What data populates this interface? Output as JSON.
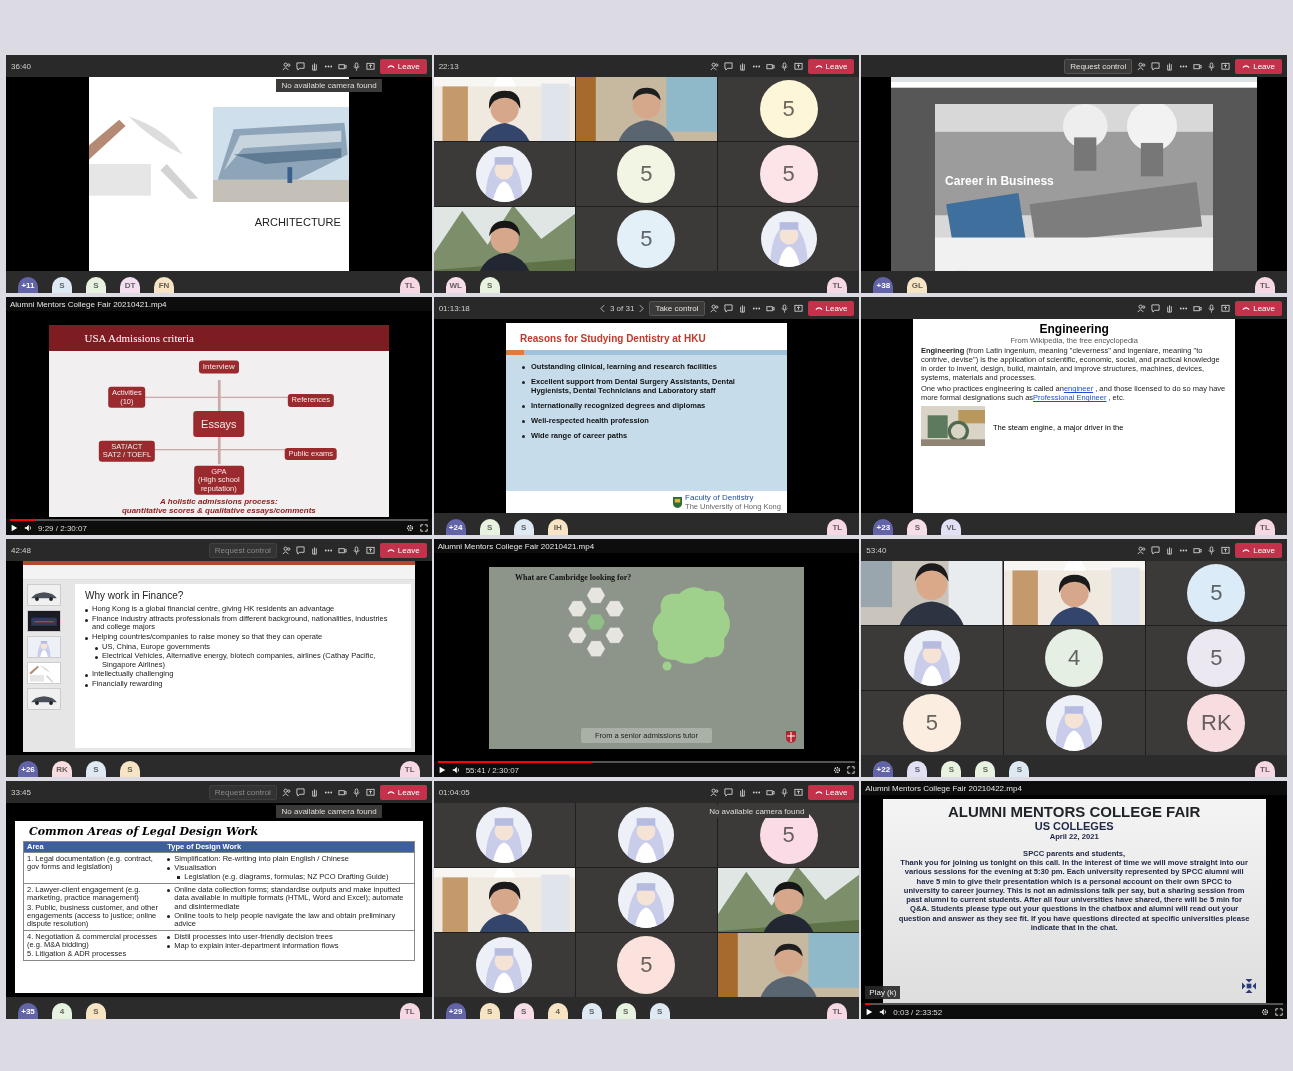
{
  "tiles": [
    {
      "kind": "teams",
      "time": "36:40",
      "leave": "Leave",
      "tooltip": "No available camera found",
      "content": {
        "kind": "architecture",
        "title": "ARCHITECTURE"
      },
      "strip": [
        {
          "kind": "count",
          "text": "+11",
          "color": "#6264a7"
        },
        {
          "kind": "initial",
          "text": "S",
          "color": "#dfe9f3"
        },
        {
          "kind": "initial",
          "text": "S",
          "color": "#e7f3e0"
        },
        {
          "kind": "initial",
          "text": "DT",
          "color": "#f3dff0"
        },
        {
          "kind": "initial",
          "text": "FN",
          "color": "#f6e4c4"
        },
        {
          "kind": "initial",
          "text": "TL",
          "color": "#f6d8e4"
        }
      ]
    },
    {
      "kind": "teams",
      "time": "22:13",
      "leave": "Leave",
      "content": {
        "kind": "gallery",
        "people": [
          {
            "kind": "camera"
          },
          {
            "kind": "camera"
          },
          {
            "kind": "initial",
            "text": "5",
            "color": "#fdf6d8"
          },
          {
            "kind": "avatar"
          },
          {
            "kind": "initial",
            "text": "5",
            "color": "#f3f5e4"
          },
          {
            "kind": "initial",
            "text": "5",
            "color": "#fce4e8"
          },
          {
            "kind": "camera"
          },
          {
            "kind": "initial",
            "text": "5",
            "color": "#e4f0f8"
          },
          {
            "kind": "avatar"
          }
        ]
      },
      "strip": [
        {
          "kind": "initial",
          "text": "WL",
          "color": "#f6dde8"
        },
        {
          "kind": "initial",
          "text": "S",
          "color": "#e7f3e0"
        },
        {
          "kind": "initial",
          "text": "TL",
          "color": "#f6d8e4"
        }
      ]
    },
    {
      "kind": "teams",
      "request": {
        "label": "Request control",
        "disabled": false
      },
      "leave": "Leave",
      "content": {
        "kind": "business",
        "title": "Career in Business"
      },
      "strip": [
        {
          "kind": "count",
          "text": "+38",
          "color": "#6264a7"
        },
        {
          "kind": "initial",
          "text": "GL",
          "color": "#f6e4c4"
        },
        {
          "kind": "initial",
          "text": "TL",
          "color": "#f6d8e4"
        }
      ]
    },
    {
      "kind": "video",
      "file": "Alumni Mentors College Fair 20210421.mp4",
      "clock": "9:29 / 2:30:07",
      "level": 0.06,
      "content": {
        "kind": "criteria",
        "title": "USA Admissions criteria",
        "nodes": [
          {
            "text": "Interview",
            "center": false
          },
          {
            "text": "Activities\n(10)",
            "center": false
          },
          {
            "text": "References",
            "center": false
          },
          {
            "text": "Essays",
            "center": true
          },
          {
            "text": "SAT/ACT\nSAT2 / TOEFL",
            "center": false
          },
          {
            "text": "Public exams",
            "center": false
          },
          {
            "text": "GPA\n(High school\nreputation)",
            "center": false
          }
        ],
        "footer": [
          "A holistic admissions process:",
          "quantitative scores & qualitative essays/comments"
        ]
      }
    },
    {
      "kind": "teams",
      "time": "01:13:18",
      "pager": "3 of 31",
      "request": {
        "label": "Take control",
        "disabled": false
      },
      "leave": "Leave",
      "content": {
        "kind": "bullets",
        "title": "Reasons for Studying Dentistry at HKU",
        "items": [
          "Outstanding clinical, learning and research facilities",
          "Excellent support from Dental Surgery Assistants, Dental Hygienists, Dental Technicians and Laboratory staff",
          "Internationally recognized degrees and diplomas",
          "Well-respected health profession",
          "Wide range of career paths"
        ],
        "brand": "Faculty of Dentistry",
        "brand_sub": "The University of Hong Kong"
      },
      "strip": [
        {
          "kind": "count",
          "text": "+24",
          "color": "#6264a7"
        },
        {
          "kind": "initial",
          "text": "S",
          "color": "#e7f3e0"
        },
        {
          "kind": "initial",
          "text": "S",
          "color": "#dfe9f3"
        },
        {
          "kind": "initial",
          "text": "IH",
          "color": "#f6e4c4"
        },
        {
          "kind": "initial",
          "text": "TL",
          "color": "#f6d8e4"
        }
      ]
    },
    {
      "kind": "teams",
      "leave": "Leave",
      "content": {
        "kind": "engineering",
        "title": "Engineering",
        "subtitle": "From Wikipedia, the free encyclopedia",
        "para": "**Engineering** (from Latin ingenium, meaning \"cleverness\" and ingeniare, meaning \"to contrive, devise\") is the application of scientific, economic, social, and practical knowledge in order to invent, design, build, maintain, and improve structures, machines, devices, systems, materials and processes.",
        "segments": [
          {
            "text": "One who practices engineering is called an",
            "link": false
          },
          {
            "text": "engineer",
            "link": true
          },
          {
            "text": ", and those licensed to do so may have more formal designations such as",
            "link": false
          },
          {
            "text": "Professional Engineer",
            "link": true
          },
          {
            "text": ", etc.",
            "link": false
          }
        ],
        "caption": "The steam engine, a major driver in the"
      },
      "strip": [
        {
          "kind": "count",
          "text": "+23",
          "color": "#6264a7"
        },
        {
          "kind": "initial",
          "text": "S",
          "color": "#f6dde8"
        },
        {
          "kind": "initial",
          "text": "VL",
          "color": "#e2e0f4"
        },
        {
          "kind": "initial",
          "text": "TL",
          "color": "#f6d8e4"
        }
      ]
    },
    {
      "kind": "teams",
      "time": "42:48",
      "request": {
        "label": "Request control",
        "disabled": true
      },
      "leave": "Leave",
      "content": {
        "kind": "finance",
        "title": "Why work in Finance?",
        "bullets": [
          {
            "text": "Hong Kong is a global financial centre, giving HK residents an advantage"
          },
          {
            "text": "Finance industry attracts professionals from different background, nationalities, industries and college majors"
          },
          {
            "text": "Helping countries/companies to raise money so that they can operate",
            "subs": [
              "US, China, Europe governments",
              "Electrical Vehicles, Alternative energy, biotech companies, airlines (Cathay Pacific, Singapore Airlines)"
            ]
          },
          {
            "text": "Intellectually challenging"
          },
          {
            "text": "Financially rewarding"
          }
        ]
      },
      "strip": [
        {
          "kind": "count",
          "text": "+26",
          "color": "#6264a7"
        },
        {
          "kind": "initial",
          "text": "RK",
          "color": "#f8dde0"
        },
        {
          "kind": "initial",
          "text": "S",
          "color": "#dfe9f3"
        },
        {
          "kind": "initial",
          "text": "S",
          "color": "#f6e4c4"
        },
        {
          "kind": "initial",
          "text": "TL",
          "color": "#f6d8e4"
        }
      ]
    },
    {
      "kind": "video",
      "file": "Alumni Mentors College Fair 20210421.mp4",
      "clock": "55:41 / 2:30:07",
      "level": 0.37,
      "content": {
        "kind": "cambridge",
        "title": "What are Cambridge looking for?",
        "caption": "From a senior admissions tutor"
      }
    },
    {
      "kind": "teams",
      "time": "53:40",
      "leave": "Leave",
      "content": {
        "kind": "gallery",
        "people": [
          {
            "kind": "camera"
          },
          {
            "kind": "camera"
          },
          {
            "kind": "initial",
            "text": "5",
            "color": "#dcebf8"
          },
          {
            "kind": "avatar"
          },
          {
            "kind": "initial",
            "text": "4",
            "color": "#e6efe3"
          },
          {
            "kind": "initial",
            "text": "5",
            "color": "#ece8f2"
          },
          {
            "kind": "initial",
            "text": "5",
            "color": "#fbeee0"
          },
          {
            "kind": "avatar"
          },
          {
            "kind": "initial",
            "text": "RK",
            "color": "#f8dde0"
          }
        ]
      },
      "strip": [
        {
          "kind": "count",
          "text": "+22",
          "color": "#6264a7"
        },
        {
          "kind": "initial",
          "text": "S",
          "color": "#e2e0f4"
        },
        {
          "kind": "initial",
          "text": "S",
          "color": "#e7f3e0"
        },
        {
          "kind": "initial",
          "text": "S",
          "color": "#e7f3e0"
        },
        {
          "kind": "initial",
          "text": "S",
          "color": "#dfe9f3"
        },
        {
          "kind": "initial",
          "text": "TL",
          "color": "#f6d8e4"
        }
      ]
    },
    {
      "kind": "teams",
      "time": "33:45",
      "request": {
        "label": "Request control",
        "disabled": true
      },
      "leave": "Leave",
      "tooltip": "No available camera found",
      "content": {
        "kind": "legal",
        "title": "Common Areas of Legal Design Work",
        "columns": [
          "Area",
          "Type of Design Work"
        ],
        "groups": [
          {
            "areas": [
              "1.  Legal documentation (e.g. contract, gov forms and legislation)"
            ],
            "work": [
              {
                "text": "Simplification: Re-writing into plain English / Chinese",
                "sub": false
              },
              {
                "text": "Visualisation",
                "sub": false
              },
              {
                "text": "Legislation (e.g. diagrams, formulas; NZ PCO Drafting Guide)",
                "sub": true
              }
            ]
          },
          {
            "areas": [
              "2.  Lawyer-client engagement (e.g. marketing, practice management)",
              "3.  Public, business customer, and other engagements (access to justice; online dispute resolution)"
            ],
            "work": [
              {
                "text": "Online data collection forms; standardise outputs and make inputted data available in multiple formats (HTML, Word and Excel); automate and disintermediate",
                "sub": false
              },
              {
                "text": "Online tools to help people navigate the law and obtain preliminary advice",
                "sub": false
              }
            ]
          },
          {
            "areas": [
              "4.  Negotiation & commercial processes (e.g. M&A bidding)",
              "5.  Litigation & ADR processes"
            ],
            "work": [
              {
                "text": "Distil processes into user-friendly decision trees",
                "sub": false
              },
              {
                "text": "Map to explain inter-department information flows",
                "sub": false
              }
            ]
          }
        ]
      },
      "strip": [
        {
          "kind": "count",
          "text": "+35",
          "color": "#6264a7"
        },
        {
          "kind": "initial",
          "text": "4",
          "color": "#e7f3e0"
        },
        {
          "kind": "initial",
          "text": "S",
          "color": "#f6e4c4"
        },
        {
          "kind": "initial",
          "text": "TL",
          "color": "#f6d8e4"
        }
      ]
    },
    {
      "kind": "teams",
      "time": "01:04:05",
      "leave": "Leave",
      "tooltip": "No available camera found",
      "content": {
        "kind": "gallery",
        "people": [
          {
            "kind": "avatar"
          },
          {
            "kind": "avatar"
          },
          {
            "kind": "initial",
            "text": "5",
            "color": "#fbdce6"
          },
          {
            "kind": "camera"
          },
          {
            "kind": "avatar"
          },
          {
            "kind": "camera"
          },
          {
            "kind": "avatar"
          },
          {
            "kind": "initial",
            "text": "5",
            "color": "#fbe2dc"
          },
          {
            "kind": "camera"
          }
        ]
      },
      "strip": [
        {
          "kind": "count",
          "text": "+29",
          "color": "#6264a7"
        },
        {
          "kind": "initial",
          "text": "S",
          "color": "#f6e4c4"
        },
        {
          "kind": "initial",
          "text": "S",
          "color": "#f6dde8"
        },
        {
          "kind": "initial",
          "text": "4",
          "color": "#f6e4c4"
        },
        {
          "kind": "initial",
          "text": "S",
          "color": "#dfe9f3"
        },
        {
          "kind": "initial",
          "text": "S",
          "color": "#e7f3e0"
        },
        {
          "kind": "initial",
          "text": "S",
          "color": "#dfe9f3"
        },
        {
          "kind": "initial",
          "text": "TL",
          "color": "#f6d8e4"
        }
      ]
    },
    {
      "kind": "video",
      "file": "Alumni Mentors College Fair 20210422.mp4",
      "clock": "0:03 / 2:33:52",
      "level": 0.01,
      "tooltip": "Play (k)",
      "content": {
        "kind": "fair",
        "title": "ALUMNI MENTORS COLLEGE FAIR",
        "subtitle": "US COLLEGES",
        "date": "April 22, 2021",
        "greeting": "SPCC parents and students,",
        "body": "Thank you for joining us tonight on this call. In the interest of time we will move straight into our various sessions for the evening at 5:30 pm. Each university represented by SPCC alumni will have 5 min to give their presentation which is a personal account on their own SPCC to university to career journey. This is not an admissions talk per say, but a sharing session from past alumni to current students. After all four universities have shared, there will be 5 min for Q&A. Students please type out your questions in the chatbox and alumni will read out your question and answer as they see fit. If you have questions directed at specific universities please indicate that in the chat."
      }
    }
  ]
}
